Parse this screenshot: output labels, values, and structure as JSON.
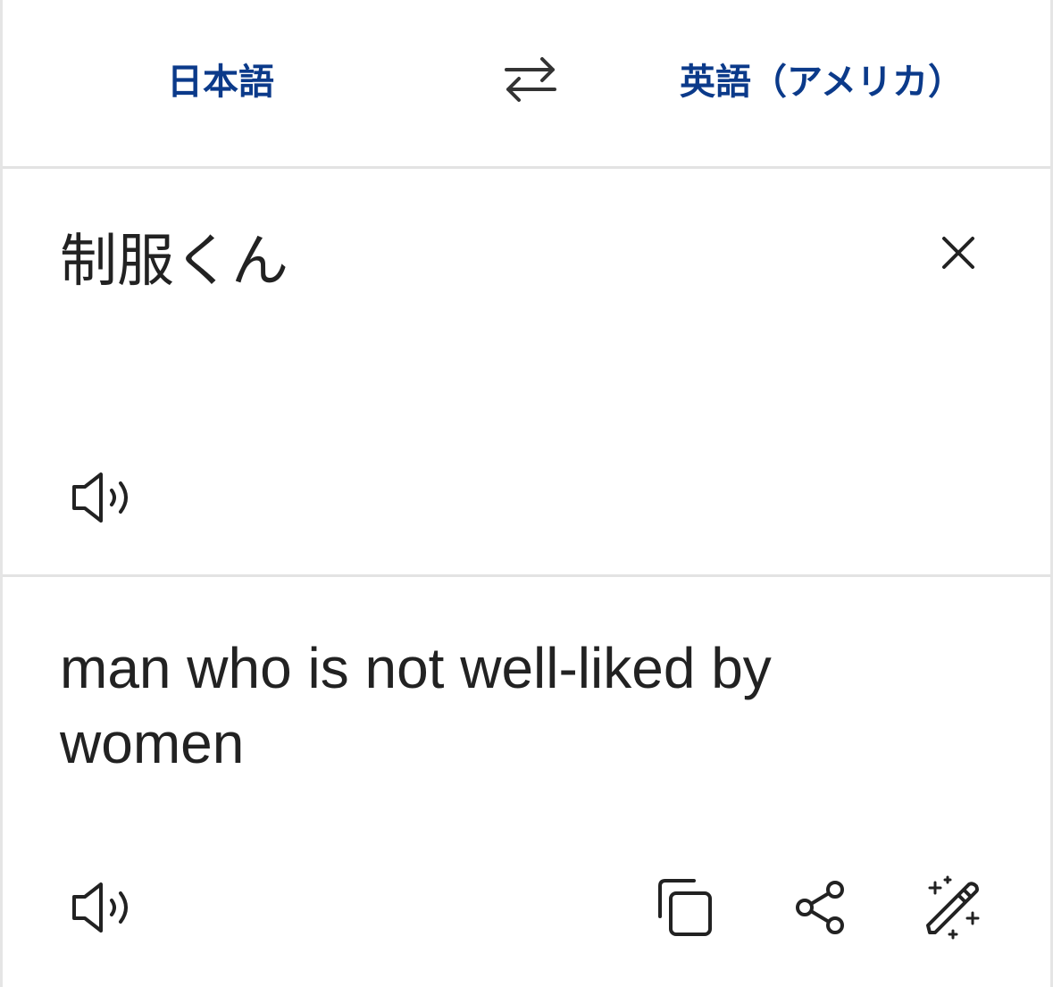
{
  "language_bar": {
    "source_language": "日本語",
    "target_language": "英語（アメリカ）",
    "swap_icon": "swap-arrows-icon"
  },
  "source": {
    "text": "制服くん",
    "clear_icon": "close-icon",
    "speak_icon": "speaker-icon"
  },
  "translation": {
    "text": "man who is not well-liked by women",
    "speak_icon": "speaker-icon",
    "actions": {
      "copy_icon": "copy-icon",
      "share_icon": "share-icon",
      "refine_icon": "magic-pen-icon"
    }
  },
  "colors": {
    "language_label": "#0b3a8a",
    "text": "#222222",
    "divider": "#e3e3e3"
  }
}
